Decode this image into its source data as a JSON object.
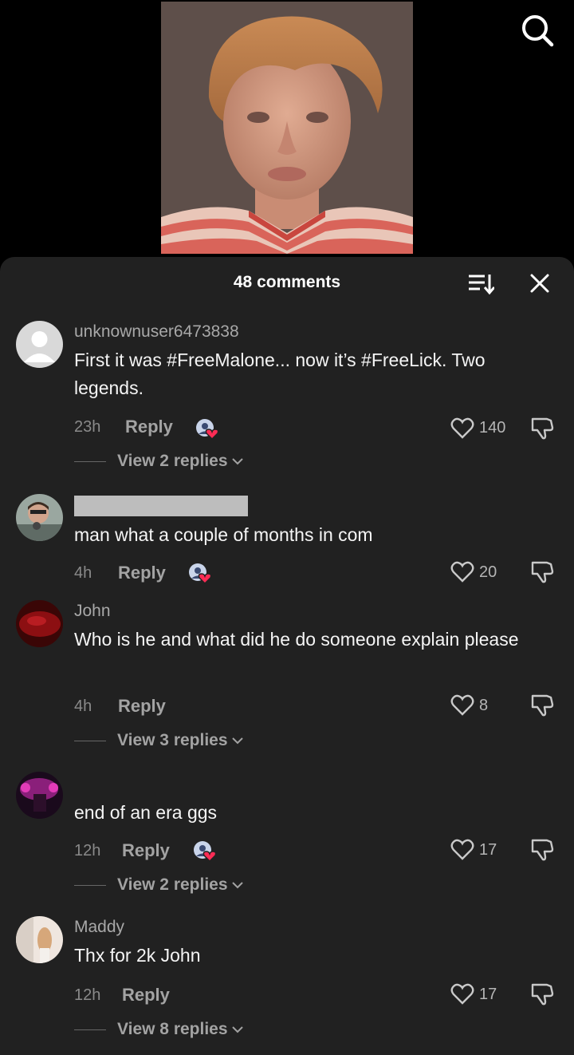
{
  "header": {
    "comment_count": "48 comments"
  },
  "comments": [
    {
      "username": "unknownuser6473838",
      "text": "First it was #FreeMalone... now it’s #FreeLick. Two legends.",
      "time": "23h",
      "reply_label": "Reply",
      "likes": "140",
      "view_replies": "View 2 replies"
    },
    {
      "username": "",
      "text": "man what a couple of months in com",
      "time": "4h",
      "reply_label": "Reply",
      "likes": "20"
    },
    {
      "username": "John",
      "text": "Who is he and what did he do someone explain please",
      "time": "4h",
      "reply_label": "Reply",
      "likes": "8",
      "view_replies": "View 3 replies"
    },
    {
      "username": "",
      "text": "end of an era ggs",
      "time": "12h",
      "reply_label": "Reply",
      "likes": "17",
      "view_replies": "View 2 replies"
    },
    {
      "username": "Maddy",
      "text": "Thx for 2k John",
      "time": "12h",
      "reply_label": "Reply",
      "likes": "17",
      "view_replies": "View 8 replies"
    }
  ],
  "icons": {
    "search": "search-icon",
    "sort": "sort-icon",
    "close": "close-icon",
    "like": "heart-icon",
    "dislike": "thumbs-down-icon",
    "creator_badge": "creator-liked-icon"
  },
  "colors": {
    "sheet_background": "#212121",
    "badge_heart": "#fe2c55",
    "secondary_text": "#a8a8a8"
  }
}
